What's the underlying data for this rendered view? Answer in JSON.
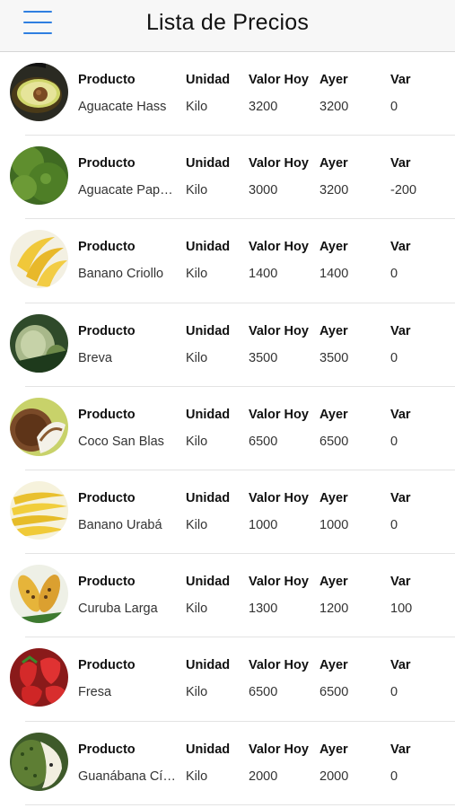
{
  "header": {
    "title": "Lista de Precios",
    "menu_icon": "hamburger-menu-icon"
  },
  "columns": {
    "producto": "Producto",
    "unidad": "Unidad",
    "valor_hoy": "Valor Hoy",
    "ayer": "Ayer",
    "var": "Var"
  },
  "items": [
    {
      "producto": "Aguacate Hass",
      "unidad": "Kilo",
      "valor_hoy": "3200",
      "ayer": "3200",
      "var": "0",
      "image": "avocado-hass-image"
    },
    {
      "producto": "Aguacate Papelillo",
      "unidad": "Kilo",
      "valor_hoy": "3000",
      "ayer": "3200",
      "var": "-200",
      "image": "avocado-green-image"
    },
    {
      "producto": "Banano Criollo",
      "unidad": "Kilo",
      "valor_hoy": "1400",
      "ayer": "1400",
      "var": "0",
      "image": "banana-criollo-image"
    },
    {
      "producto": "Breva",
      "unidad": "Kilo",
      "valor_hoy": "3500",
      "ayer": "3500",
      "var": "0",
      "image": "breva-fig-image"
    },
    {
      "producto": "Coco San Blas",
      "unidad": "Kilo",
      "valor_hoy": "6500",
      "ayer": "6500",
      "var": "0",
      "image": "coconut-image"
    },
    {
      "producto": "Banano Urabá",
      "unidad": "Kilo",
      "valor_hoy": "1000",
      "ayer": "1000",
      "var": "0",
      "image": "banana-uraba-image"
    },
    {
      "producto": "Curuba Larga",
      "unidad": "Kilo",
      "valor_hoy": "1300",
      "ayer": "1200",
      "var": "100",
      "image": "curuba-image"
    },
    {
      "producto": "Fresa",
      "unidad": "Kilo",
      "valor_hoy": "6500",
      "ayer": "6500",
      "var": "0",
      "image": "strawberry-image"
    },
    {
      "producto": "Guanábana Cítrica",
      "unidad": "Kilo",
      "valor_hoy": "2000",
      "ayer": "2000",
      "var": "0",
      "image": "soursop-image"
    }
  ]
}
